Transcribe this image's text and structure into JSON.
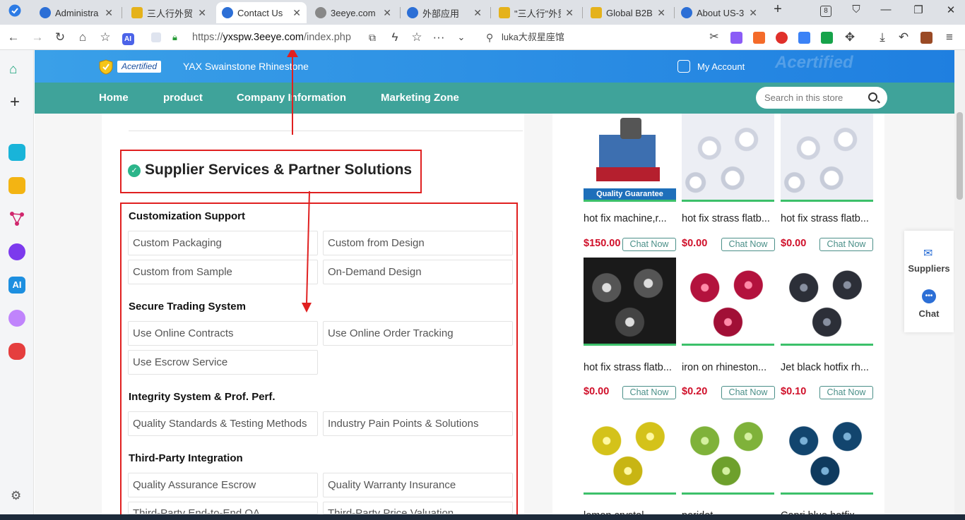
{
  "browser": {
    "tabs": [
      {
        "title": "Administra",
        "favicon_color": "#2c6fd6"
      },
      {
        "title": "三人行外贸",
        "favicon_color": "#e5b21b"
      },
      {
        "title": "Contact Us",
        "favicon_color": "#2c6fd6"
      },
      {
        "title": "3eeye.com",
        "favicon_color": "#777777"
      },
      {
        "title": "外部应用",
        "favicon_color": "#2c6fd6"
      },
      {
        "title": "\"三人行\"外贸",
        "favicon_color": "#e5b21b"
      },
      {
        "title": "Global B2B",
        "favicon_color": "#e5b21b"
      },
      {
        "title": "About US-3",
        "favicon_color": "#2c6fd6"
      }
    ],
    "new_tab": "+",
    "tab_count": "8",
    "url_prefix": "https://",
    "url_domain": "yxspw.3eeye.com",
    "url_path": "/index.php",
    "search_text": "luka大叔星座馆"
  },
  "site": {
    "acertified_badge": "Acertified",
    "store_name": "YAX Swainstone Rhinestone",
    "my_account": "My Account",
    "watermark": "Acertified",
    "nav": [
      "Home",
      "product",
      "Company Information",
      "Marketing Zone"
    ],
    "search_placeholder": "Search in this store"
  },
  "services": {
    "title": "Supplier Services & Partner Solutions",
    "groups": [
      {
        "title": "Customization Support",
        "items": [
          "Custom Packaging",
          "Custom from Design",
          "Custom from Sample",
          "On-Demand Design"
        ]
      },
      {
        "title": "Secure Trading System",
        "items": [
          "Use Online Contracts",
          "Use Online Order Tracking",
          "Use Escrow Service"
        ]
      },
      {
        "title": "Integrity System & Prof. Perf.",
        "items": [
          "Quality Standards & Testing Methods",
          "Industry Pain Points & Solutions"
        ]
      },
      {
        "title": "Third-Party Integration",
        "items": [
          "Quality Assurance Escrow",
          "Quality Warranty Insurance",
          "Third-Party End-to-End QA",
          "Third-Party Price Valuation"
        ]
      }
    ]
  },
  "products": [
    {
      "name": "hot fix machine,r...",
      "price": "$150.00",
      "chat": "Chat Now",
      "img": "machine",
      "caption": "Quality Guarantee"
    },
    {
      "name": "hot fix strass flatb...",
      "price": "$0.00",
      "chat": "Chat Now",
      "img": "crystal"
    },
    {
      "name": "hot fix strass flatb...",
      "price": "$0.00",
      "chat": "Chat Now",
      "img": "crystal"
    },
    {
      "name": "hot fix strass flatb...",
      "price": "$0.00",
      "chat": "Chat Now",
      "img": "dark-grey"
    },
    {
      "name": "iron on rhineston...",
      "price": "$0.20",
      "chat": "Chat Now",
      "img": "ruby"
    },
    {
      "name": "Jet black hotfix rh...",
      "price": "$0.10",
      "chat": "Chat Now",
      "img": "jet"
    },
    {
      "name": "lemon crystal ...",
      "price": "",
      "chat": "",
      "img": "yellow"
    },
    {
      "name": "peridot ...",
      "price": "",
      "chat": "",
      "img": "green"
    },
    {
      "name": "Capri blue hotfix ...",
      "price": "",
      "chat": "",
      "img": "navy"
    }
  ],
  "float_widget": {
    "suppliers": "Suppliers",
    "chat": "Chat"
  },
  "colors": {
    "brand_blue": "#1f7fe0",
    "nav_teal": "#3fa39a",
    "annotation_red": "#e02020",
    "price_red": "#d0102a"
  }
}
